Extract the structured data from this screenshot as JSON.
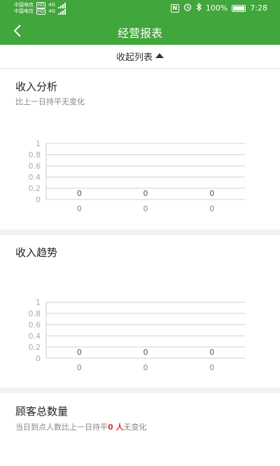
{
  "status_bar": {
    "carrier_1": "中国电信",
    "carrier_1_tag": "HD",
    "carrier_1_net": "4G",
    "carrier_2": "中国电信",
    "carrier_2_tag": "HD",
    "carrier_2_net": "4G",
    "nfc": "N",
    "battery": "100%",
    "time": "7:28"
  },
  "app_bar": {
    "title": "经营报表"
  },
  "collapse": {
    "label": "收起列表"
  },
  "income_analysis": {
    "title": "收入分析",
    "subtitle": "比上一日持平无变化"
  },
  "income_trend": {
    "title": "收入趋势"
  },
  "customers": {
    "title": "顾客总数量",
    "subtitle_prefix": "当日到点人数比上一日持平",
    "subtitle_value": "0",
    "subtitle_unit": " 人",
    "subtitle_suffix": "无变化"
  },
  "colors": {
    "accent": "#41a63b",
    "highlight": "#e03030"
  },
  "chart_data": [
    {
      "type": "bar",
      "categories": [
        "0",
        "0",
        "0"
      ],
      "values": [
        0,
        0,
        0
      ],
      "data_labels": [
        "0",
        "0",
        "0"
      ],
      "ylim": [
        0,
        1
      ],
      "yticks": [
        "0",
        "0.2",
        "0.4",
        "0.6",
        "0.8",
        "1"
      ],
      "grid": true
    },
    {
      "type": "line",
      "categories": [
        "0",
        "0",
        "0"
      ],
      "values": [
        0,
        0,
        0
      ],
      "data_labels": [
        "0",
        "0",
        "0"
      ],
      "ylim": [
        0,
        1
      ],
      "yticks": [
        "0",
        "0.2",
        "0.4",
        "0.6",
        "0.8",
        "1"
      ],
      "grid": true
    }
  ]
}
